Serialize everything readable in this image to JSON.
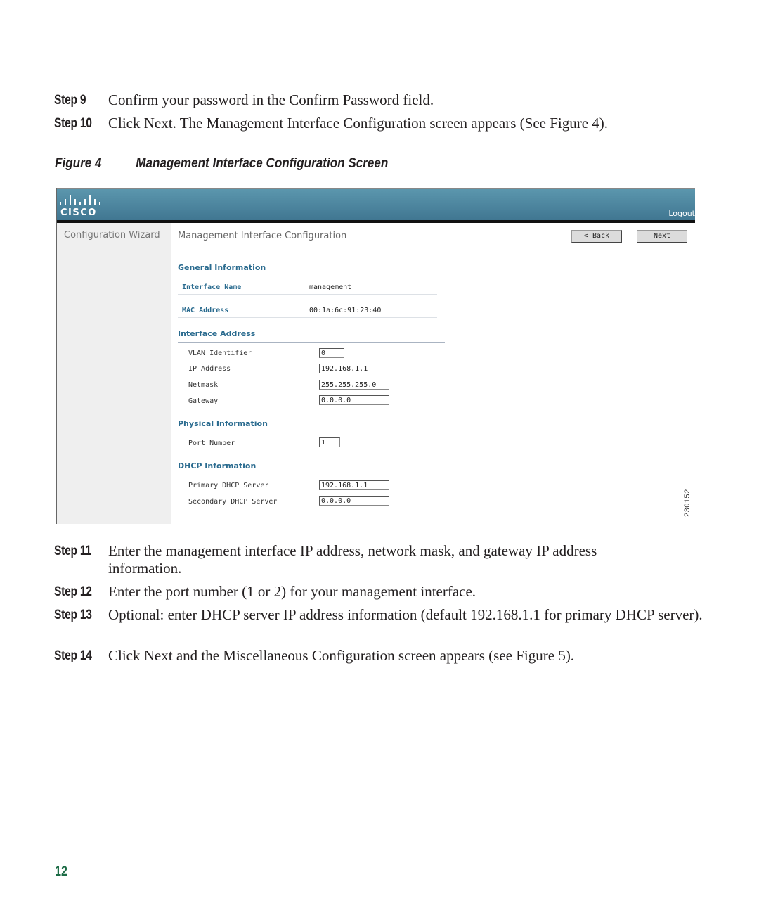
{
  "steps_before": [
    {
      "label": "Step 9",
      "text": "Confirm your password in the Confirm Password field."
    },
    {
      "label": "Step 10",
      "text_parts": [
        "Click ",
        "Next",
        ". The Management Interface Configuration screen appears (See ",
        "Figure 4",
        ")."
      ]
    }
  ],
  "figure": {
    "number": "Figure 4",
    "title": "Management Interface Configuration Screen",
    "id_number": "230152"
  },
  "ui": {
    "brand": "CISCO",
    "logout": "Logout",
    "sidebar_title": "Configuration Wizard",
    "page_title": "Management Interface Configuration",
    "back_button": "< Back",
    "next_button": "Next",
    "general_information": {
      "title": "General Information",
      "rows": [
        {
          "label": "Interface Name",
          "value": "management"
        },
        {
          "label": "MAC Address",
          "value": "00:1a:6c:91:23:40"
        }
      ]
    },
    "interface_address": {
      "title": "Interface Address",
      "fields": [
        {
          "label": "VLAN Identifier",
          "value": "0"
        },
        {
          "label": "IP Address",
          "value": "192.168.1.1"
        },
        {
          "label": "Netmask",
          "value": "255.255.255.0"
        },
        {
          "label": "Gateway",
          "value": "0.0.0.0"
        }
      ]
    },
    "physical_information": {
      "title": "Physical Information",
      "fields": [
        {
          "label": "Port Number",
          "value": "1"
        }
      ]
    },
    "dhcp_information": {
      "title": "DHCP Information",
      "fields": [
        {
          "label": "Primary DHCP Server",
          "value": "192.168.1.1"
        },
        {
          "label": "Secondary DHCP Server",
          "value": "0.0.0.0"
        }
      ]
    }
  },
  "steps_after": [
    {
      "label": "Step 11",
      "text": "Enter the management interface IP address, network mask, and gateway IP address information."
    },
    {
      "label": "Step 12",
      "text": "Enter the port number (1 or 2) for your management interface."
    },
    {
      "label": "Step 13",
      "text": "Optional: enter DHCP server IP address information (default 192.168.1.1 for primary DHCP server)."
    },
    {
      "label": "Step 14",
      "text_parts": [
        "Click ",
        "Next",
        " and the Miscellaneous Configuration screen appears (see Figure 5)."
      ]
    }
  ],
  "page_number": "12",
  "colors": {
    "banner": "#4a85a0",
    "section_title": "#2a6b8f",
    "page_number": "#1b6b45"
  }
}
